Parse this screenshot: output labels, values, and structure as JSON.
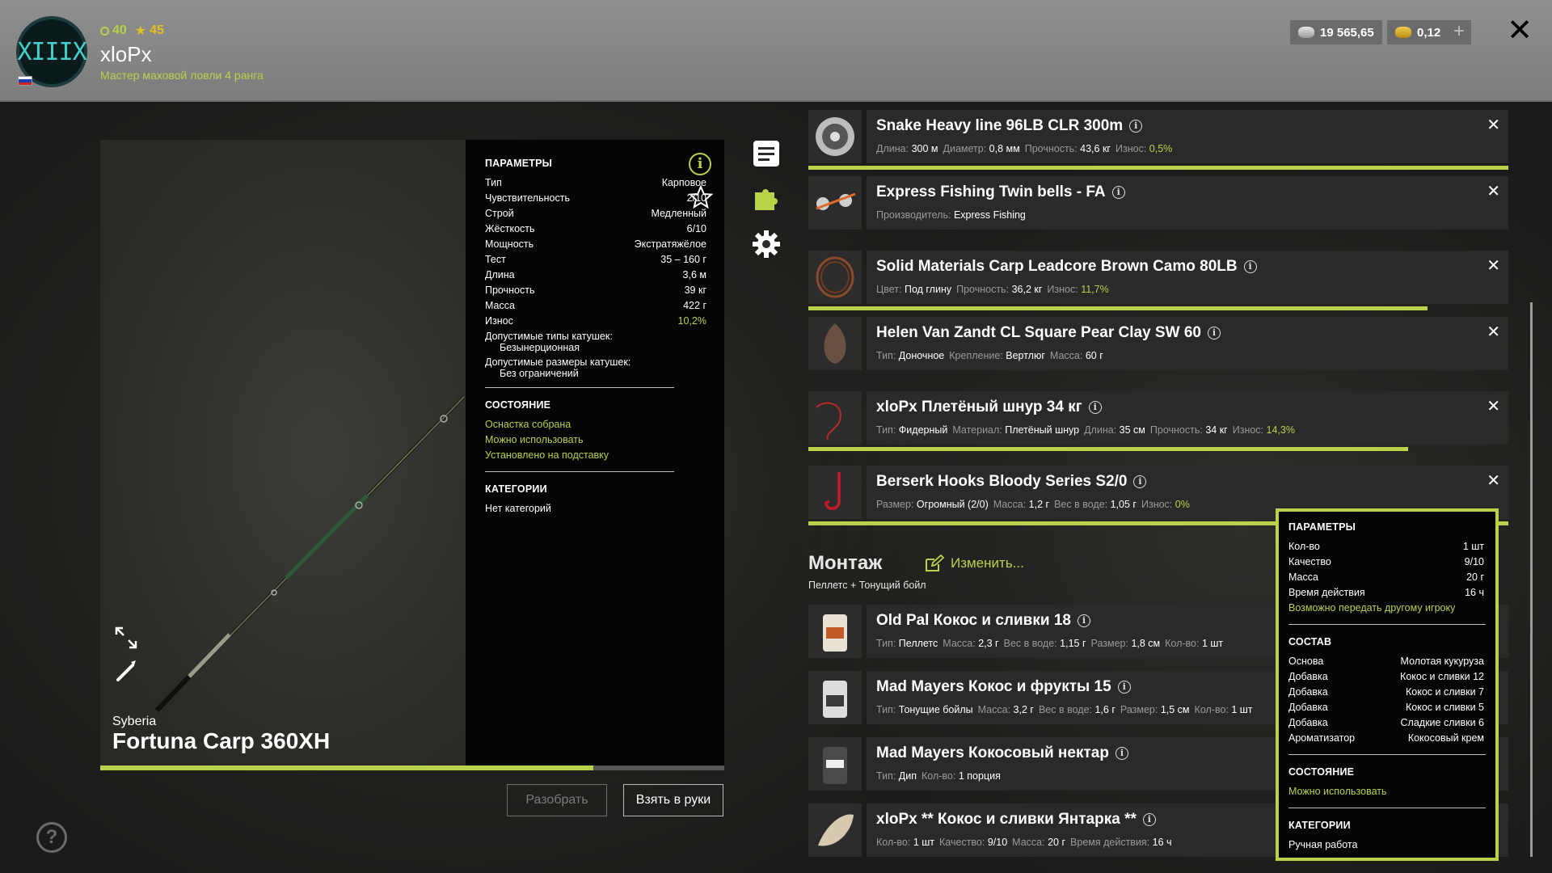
{
  "header": {
    "avatar_text": "XIIIX",
    "experience": "40",
    "level": "45",
    "nickname": "xloPx",
    "rank": "Мастер маховой ловли 4 ранга",
    "silver": "19 565,65",
    "gold": "0,12",
    "add_label": "+",
    "close_label": "✕"
  },
  "rod": {
    "brand": "Syberia",
    "name": "Fortuna Carp 360XH",
    "wear_progress": 0.79,
    "params_title": "Параметры",
    "params": [
      {
        "label": "Тип",
        "value": "Карповое"
      },
      {
        "label": "Чувствительность",
        "value": "2/10"
      },
      {
        "label": "Строй",
        "value": "Медленный"
      },
      {
        "label": "Жёсткость",
        "value": "6/10"
      },
      {
        "label": "Мощность",
        "value": "Экстратяжёлое"
      },
      {
        "label": "Тест",
        "value": "35 – 160 г"
      },
      {
        "label": "Длина",
        "value": "3,6 м"
      },
      {
        "label": "Прочность",
        "value": "39 кг"
      },
      {
        "label": "Масса",
        "value": "422 г"
      },
      {
        "label": "Износ",
        "value": "10,2%"
      }
    ],
    "reel_types_label": "Допустимые типы катушек:",
    "reel_types_value": "Безынерционная",
    "reel_sizes_label": "Допустимые размеры катушек:",
    "reel_sizes_value": "Без ограничений",
    "state_title": "Состояние",
    "states": [
      "Оснастка собрана",
      "Можно использовать",
      "Установлено на подставку"
    ],
    "categories_title": "Категории",
    "categories_value": "Нет категорий"
  },
  "buttons": {
    "disassemble": "Разобрать",
    "take": "Взять в руки"
  },
  "help_label": "?",
  "tackle": [
    {
      "title": "Snake Heavy line 96LB CLR 300m",
      "meta": [
        [
          "Длина:",
          "300 м"
        ],
        [
          "Диаметр:",
          "0,8 мм"
        ],
        [
          "Прочность:",
          "43,6 кг"
        ],
        [
          "Износ:",
          "0,5%"
        ]
      ],
      "wear_green": true,
      "progress": 1.0
    },
    {
      "title": "Express Fishing Twin bells - FA",
      "meta": [
        [
          "Производитель:",
          "Express Fishing"
        ]
      ],
      "wear_green": false,
      "progress": null
    },
    {
      "title": "Solid Materials Carp Leadcore Brown Camo 80LB",
      "meta": [
        [
          "Цвет:",
          "Под глину"
        ],
        [
          "Прочность:",
          "36,2 кг"
        ],
        [
          "Износ:",
          "11,7%"
        ]
      ],
      "wear_green": true,
      "progress": 0.885
    },
    {
      "title": "Helen Van Zandt CL Square Pear Clay SW 60",
      "meta": [
        [
          "Тип:",
          "Доночное"
        ],
        [
          "Крепление:",
          "Вертлюг"
        ],
        [
          "Масса:",
          "60 г"
        ]
      ],
      "wear_green": false,
      "progress": null
    },
    {
      "title": "xloPx Плетёный шнур 34 кг",
      "meta": [
        [
          "Тип:",
          "Фидерный"
        ],
        [
          "Материал:",
          "Плетёный шнур"
        ],
        [
          "Длина:",
          "35 см"
        ],
        [
          "Прочность:",
          "34 кг"
        ],
        [
          "Износ:",
          "14,3%"
        ]
      ],
      "wear_green": true,
      "progress": 0.857
    },
    {
      "title": "Berserk Hooks Bloody Series S2/0",
      "meta": [
        [
          "Размер:",
          "Огромный (2/0)"
        ],
        [
          "Масса:",
          "1,2 г"
        ],
        [
          "Вес в воде:",
          "1,05 г"
        ],
        [
          "Износ:",
          "0%"
        ]
      ],
      "wear_green": true,
      "progress": 1.0
    }
  ],
  "montage": {
    "title": "Монтаж",
    "edit_label": "Изменить...",
    "subtitle": "Пеллетс  +  Тонущий бойл"
  },
  "baits": [
    {
      "title": "Old Pal Кокос и сливки 18",
      "meta": [
        [
          "Тип:",
          "Пеллетс"
        ],
        [
          "Масса:",
          "2,3 г"
        ],
        [
          "Вес в воде:",
          "1,15 г"
        ],
        [
          "Размер:",
          "1,8 см"
        ],
        [
          "Кол-во:",
          "1 шт"
        ]
      ]
    },
    {
      "title": "Mad Mayers Кокос и фрукты 15",
      "meta": [
        [
          "Тип:",
          "Тонущие бойлы"
        ],
        [
          "Масса:",
          "3,2 г"
        ],
        [
          "Вес в воде:",
          "1,6 г"
        ],
        [
          "Размер:",
          "1,5 см"
        ],
        [
          "Кол-во:",
          "1 шт"
        ]
      ]
    },
    {
      "title": "Mad Mayers Кокосовый нектар",
      "meta": [
        [
          "Тип:",
          "Дип"
        ],
        [
          "Кол-во:",
          "1 порция"
        ]
      ]
    },
    {
      "title": "xloPx ** Кокос и сливки Янтарка **",
      "meta": [
        [
          "Кол-во:",
          "1 шт"
        ],
        [
          "Качество:",
          "9/10"
        ],
        [
          "Масса:",
          "20 г"
        ],
        [
          "Время действия:",
          "16 ч"
        ]
      ]
    }
  ],
  "tooltip": {
    "params_title": "Параметры",
    "params": [
      {
        "label": "Кол-во",
        "value": "1 шт"
      },
      {
        "label": "Качество",
        "value": "9/10"
      },
      {
        "label": "Масса",
        "value": "20 г"
      },
      {
        "label": "Время действия",
        "value": "16 ч"
      }
    ],
    "transfer_note": "Возможно передать другому игроку",
    "composition_title": "Состав",
    "composition": [
      {
        "label": "Основа",
        "value": "Молотая кукуруза"
      },
      {
        "label": "Добавка",
        "value": "Кокос и сливки 12"
      },
      {
        "label": "Добавка",
        "value": "Кокос и сливки 7"
      },
      {
        "label": "Добавка",
        "value": "Кокос и сливки 5"
      },
      {
        "label": "Добавка",
        "value": "Сладкие сливки 6"
      },
      {
        "label": "Ароматизатор",
        "value": "Кокосовый крем"
      }
    ],
    "state_title": "Состояние",
    "state_value": "Можно использовать",
    "categories_title": "Категории",
    "categories_value": "Ручная работа"
  },
  "colors": {
    "accent": "#b8d24a",
    "panel": "#050505",
    "item_bg": "#2a2a2a"
  },
  "icons": [
    "exp-icon",
    "star-level-icon",
    "silver-coin-icon",
    "gold-coin-icon",
    "close-icon",
    "info-icon",
    "favorite-star-icon",
    "expand-icon",
    "brush-icon",
    "notes-icon",
    "puzzle-icon",
    "gear-icon",
    "edit-icon",
    "help-icon"
  ]
}
